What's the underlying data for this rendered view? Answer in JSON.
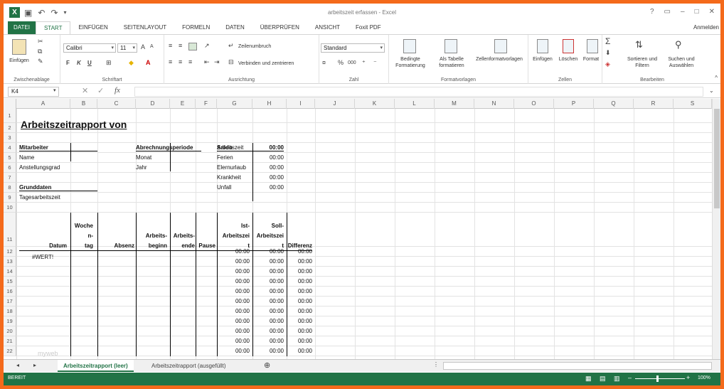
{
  "window": {
    "title": "arbeitszeit erfassen - Excel",
    "user": "Anmelden",
    "logo": "X"
  },
  "ribbon_tabs": [
    "DATEI",
    "START",
    "EINFÜGEN",
    "SEITENLAYOUT",
    "FORMELN",
    "DATEN",
    "ÜBERPRÜFEN",
    "ANSICHT",
    "Foxit PDF"
  ],
  "ribbon": {
    "clipboard": {
      "paste": "Einfügen",
      "label": "Zwischenablage"
    },
    "font": {
      "name": "Calibri",
      "size": "11",
      "bold": "F",
      "italic": "K",
      "underline": "U",
      "grow": "A",
      "shrink": "A",
      "label": "Schriftart"
    },
    "alignment": {
      "wrap": "Zeilenumbruch",
      "merge": "Verbinden und zentrieren",
      "label": "Ausrichtung"
    },
    "number": {
      "format": "Standard",
      "percent": "%",
      "thousands": "000",
      "label": "Zahl"
    },
    "styles": {
      "conditional": [
        "Bedingte",
        "Formatierung"
      ],
      "table": [
        "Als Tabelle",
        "formatieren"
      ],
      "cellstyles": "Zellenformatvorlagen",
      "label": "Formatvorlagen"
    },
    "cells": {
      "insert": "Einfügen",
      "delete": "Löschen",
      "format": "Format",
      "label": "Zellen"
    },
    "editing": {
      "sort": [
        "Sortieren und",
        "Filtern"
      ],
      "find": [
        "Suchen und",
        "Auswählen"
      ],
      "label": "Bearbeiten"
    }
  },
  "formula_bar": {
    "namebox": "K4",
    "fx": "fx",
    "cancel": "✕",
    "enter": "✓"
  },
  "columns": [
    "A",
    "B",
    "C",
    "D",
    "E",
    "F",
    "G",
    "H",
    "I",
    "J",
    "K",
    "L",
    "M",
    "N",
    "O",
    "P",
    "Q",
    "R",
    "S"
  ],
  "rows": [
    "1",
    "2",
    "3",
    "4",
    "5",
    "6",
    "7",
    "8",
    "9",
    "10",
    "11",
    "12",
    "13",
    "14",
    "15",
    "16",
    "17",
    "18",
    "19",
    "20",
    "21",
    "22"
  ],
  "cells": {
    "title": "Arbeitszeitrapport   von",
    "mitarbeiter": "Mitarbeiter",
    "name": "Name",
    "anstellungsgrad": "Anstellungsgrad",
    "grunddaten": "Grunddaten",
    "tagesarbeitszeit": "Tagesarbeitszeit",
    "abrechnungsperiode": "Abrechnungsperiode",
    "monat": "Monat",
    "jahr": "Jahr",
    "saldo": "Saldo",
    "saldo_items": [
      {
        "label": "Arbeitszeit",
        "value": "00:00"
      },
      {
        "label": "Ferien",
        "value": "00:00"
      },
      {
        "label": "Elernurlaub",
        "value": "00:00"
      },
      {
        "label": "Krankheit",
        "value": "00:00"
      },
      {
        "label": "Unfall",
        "value": "00:00"
      }
    ],
    "headers": {
      "datum": "Datum",
      "wochentag": [
        "Woche",
        "n-",
        "tag"
      ],
      "absenz": "Absenz",
      "beginn": [
        "Arbeits-",
        "beginn"
      ],
      "ende": [
        "Arbeits-",
        "ende"
      ],
      "pause": "Pause",
      "ist": [
        "Ist-",
        "Arbeitszei",
        "t"
      ],
      "soll": [
        "Soll-",
        "Arbeitszei",
        "t"
      ],
      "differenz": "Differenz"
    },
    "error_value": "#WERT!",
    "time_value": "00:00"
  },
  "sheet_tabs": [
    "Arbeitszeitrapport (leer)",
    "Arbeitszeitrapport (ausgefüllt)"
  ],
  "add_sheet": "⊕",
  "status": {
    "ready": "BEREIT",
    "zoom": "100%"
  },
  "watermark": "myweb"
}
